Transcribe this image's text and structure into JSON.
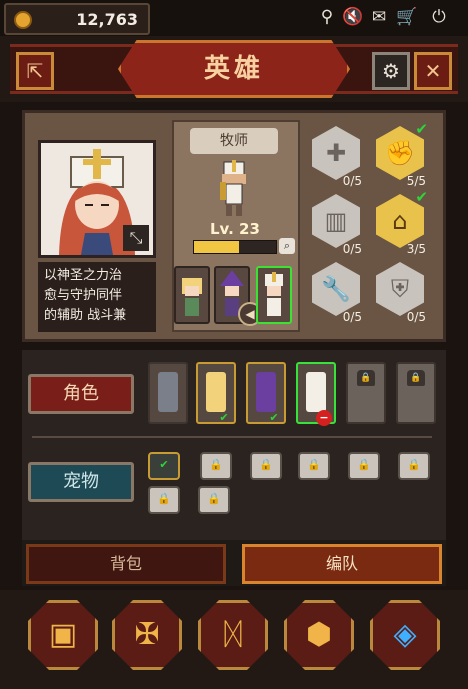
{
  "topbar": {
    "coins": "12,763",
    "icons": [
      "pin-icon",
      "volume-mute-icon",
      "mail-icon",
      "cart-icon",
      "power-icon"
    ]
  },
  "header": {
    "title": "英雄",
    "left_button_icon": "back-exit-icon",
    "gear_icon": "gear-icon",
    "close_icon": "close-icon"
  },
  "hero": {
    "class_name": "牧师",
    "level": "Lv. 23",
    "xp_fraction": 0.55,
    "description": "以神圣之力治愈与守护同伴的辅助战斗兼",
    "desc_lines": [
      "以神圣之力治",
      "愈与守护同伴",
      "的辅助 战斗兼"
    ],
    "party": [
      "hero-blonde",
      "hero-witch",
      "hero-priest"
    ],
    "selected_party_index": 2,
    "skills": [
      {
        "icon": "cross-shield-icon",
        "count": "0/5",
        "active": false,
        "checked": false
      },
      {
        "icon": "fist-icon",
        "count": "5/5",
        "active": true,
        "checked": true
      },
      {
        "icon": "pillar-icon",
        "count": "0/5",
        "active": false,
        "checked": false
      },
      {
        "icon": "house-icon",
        "count": "3/5",
        "active": true,
        "checked": true
      },
      {
        "icon": "wrench-icon",
        "count": "0/5",
        "active": false,
        "checked": false
      },
      {
        "icon": "armor-icon",
        "count": "0/5",
        "active": false,
        "checked": false
      }
    ]
  },
  "roles": {
    "label": "角色",
    "slots": [
      {
        "type": "knight",
        "border": "none",
        "badge": ""
      },
      {
        "type": "blonde",
        "border": "gold",
        "badge": "check"
      },
      {
        "type": "witch",
        "border": "gold",
        "badge": "check"
      },
      {
        "type": "priest",
        "border": "green",
        "badge": "remove"
      },
      {
        "type": "locked",
        "border": "none",
        "badge": ""
      },
      {
        "type": "locked",
        "border": "none",
        "badge": ""
      }
    ]
  },
  "pets": {
    "label": "宠物",
    "slots": [
      "pet-equipped",
      "locked",
      "locked",
      "locked",
      "locked",
      "locked",
      "locked",
      "locked"
    ]
  },
  "tabs": {
    "bag": "背包",
    "team": "编队"
  },
  "nav": [
    "chest-icon",
    "cross-icon",
    "rune-icon",
    "box-icon",
    "blue-gem-icon"
  ],
  "colors": {
    "accent": "#c9772e",
    "select_green": "#39e23a",
    "xp_yellow": "#f0c642"
  }
}
